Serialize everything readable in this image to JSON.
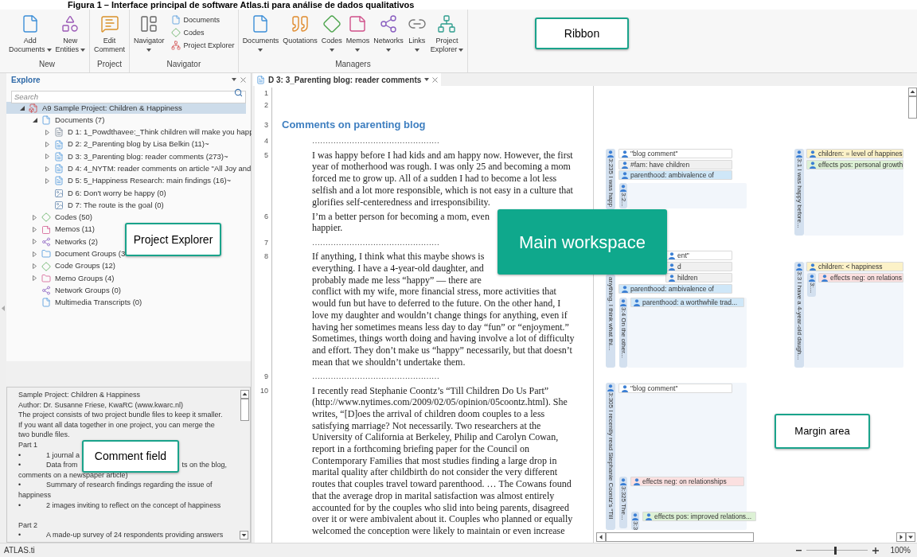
{
  "caption": "Figura 1 – Interface principal de software Atlas.ti para análise de dados qualitativos",
  "ribbon": {
    "groups": [
      {
        "label": "New",
        "buttons": [
          {
            "lines": [
              "Add",
              "Documents"
            ],
            "dropdown": true
          },
          {
            "lines": [
              "New",
              "Entities"
            ],
            "dropdown": true
          }
        ]
      },
      {
        "label": "Project",
        "buttons": [
          {
            "lines": [
              "Edit",
              "Comment"
            ],
            "dropdown": false
          }
        ]
      },
      {
        "label": "Navigator",
        "buttons": [
          {
            "lines": [
              "Navigator"
            ],
            "dropdown": true
          }
        ],
        "small_buttons": [
          "Documents",
          "Codes",
          "Project Explorer"
        ]
      },
      {
        "label": "Managers",
        "buttons": [
          {
            "lines": [
              "Documents"
            ],
            "dropdown": true
          },
          {
            "lines": [
              "Quotations"
            ],
            "dropdown": false
          },
          {
            "lines": [
              "Codes"
            ],
            "dropdown": true
          },
          {
            "lines": [
              "Memos"
            ],
            "dropdown": true
          },
          {
            "lines": [
              "Networks"
            ],
            "dropdown": true
          },
          {
            "lines": [
              "Links"
            ],
            "dropdown": true
          },
          {
            "lines": [
              "Project",
              "Explorer"
            ],
            "dropdown": true
          }
        ]
      }
    ]
  },
  "explorer": {
    "title": "Explore",
    "search": {
      "placeholder": "Search"
    },
    "tree": [
      {
        "label": "A9 Sample Project: Children & Happiness",
        "kind": "project",
        "expanded": true,
        "selected": true,
        "children": [
          {
            "label": "Documents (7)",
            "kind": "documents",
            "expanded": true,
            "selected": false,
            "children": [
              {
                "label": "D 1: 1_Powdthavee:_Think children will make you happ",
                "kind": "pdf",
                "expanded": false,
                "selected": false
              },
              {
                "label": "D 2: 2_Parenting blog by Lisa Belkin (11)~",
                "kind": "text",
                "expanded": false,
                "selected": false
              },
              {
                "label": "D 3: 3_Parenting blog: reader comments (273)~",
                "kind": "text",
                "expanded": false,
                "selected": false
              },
              {
                "label": "D 4: 4_NYTM: reader comments on article \"All Joy and",
                "kind": "text",
                "expanded": false,
                "selected": false
              },
              {
                "label": "D 5: 5_Happiness Research: main findings (16)~",
                "kind": "text",
                "expanded": false,
                "selected": false
              },
              {
                "label": "D 6: Don't worry be happy (0)",
                "kind": "image",
                "selected": false
              },
              {
                "label": "D 7: The route is the goal (0)",
                "kind": "image",
                "selected": false
              }
            ]
          },
          {
            "label": "Codes (50)",
            "kind": "codes",
            "expanded": false,
            "selected": false
          },
          {
            "label": "Memos (11)",
            "kind": "memos",
            "expanded": false,
            "selected": false
          },
          {
            "label": "Networks (2)",
            "kind": "networks",
            "expanded": false,
            "selected": false
          },
          {
            "label": "Document Groups (3",
            "kind": "docgroups",
            "expanded": false,
            "selected": false
          },
          {
            "label": "Code Groups (12)",
            "kind": "codegroups",
            "expanded": false,
            "selected": false
          },
          {
            "label": "Memo Groups (4)",
            "kind": "memogroups",
            "expanded": false,
            "selected": false
          },
          {
            "label": "Network Groups (0)",
            "kind": "netgroups",
            "selected": false
          },
          {
            "label": "Multimedia Transcripts (0)",
            "kind": "transcripts",
            "selected": false
          }
        ]
      }
    ]
  },
  "comment": {
    "lines": [
      {
        "kind": "text",
        "text": "Sample Project: Children & Happiness"
      },
      {
        "kind": "text",
        "text": "Author: Dr. Susanne Friese, KwaRC (www.kwarc.nl)"
      },
      {
        "kind": "text",
        "text": "The project consists of two project bundle files to keep it smaller."
      },
      {
        "kind": "text",
        "text": "If you want all data together in one project, you can merge the"
      },
      {
        "kind": "text",
        "text": "two bundle files."
      },
      {
        "kind": "text",
        "text": "Part 1"
      },
      {
        "kind": "bullet",
        "marker": "•",
        "text": "1 journal a"
      },
      {
        "kind": "bullet",
        "marker": "•",
        "text": "Data from",
        "tail": "ts on the blog,"
      },
      {
        "kind": "text",
        "text": "comments on a newspaper article)"
      },
      {
        "kind": "bullet",
        "marker": "•",
        "text": "Summary of research findings regarding the issue of"
      },
      {
        "kind": "text",
        "text": "happiness"
      },
      {
        "kind": "bullet",
        "marker": "•",
        "text": "2 images inviting to reflect on the concept of happiness"
      },
      {
        "kind": "blank"
      },
      {
        "kind": "text",
        "text": "Part 2"
      },
      {
        "kind": "bullet",
        "marker": "•",
        "text": "A made-up survey of 24 respondents providing answers"
      }
    ]
  },
  "document": {
    "tab": {
      "label": "D 3: 3_Parenting blog: reader comments",
      "selected": true
    },
    "rows": [
      {
        "number": "1",
        "kind": "blank"
      },
      {
        "number": "2",
        "kind": "blank"
      },
      {
        "number": "3",
        "kind": "heading",
        "lines": [
          "Comments on parenting blog"
        ]
      },
      {
        "number": "4",
        "kind": "separator",
        "lines": [
          "…………………………………………"
        ]
      },
      {
        "number": "5",
        "kind": "paragraph",
        "lines": [
          "I was happy before I had kids and am happy now. However, the first",
          "year of motherhood was rough. I was only 25 and becoming a mom",
          "forced me to grow up. All of a sudden I had to become a lot less",
          "selfish and a lot more responsible, which is not easy in a culture that",
          "glorifies self-centeredness and irresponsibility."
        ]
      },
      {
        "number": "6",
        "kind": "paragraph",
        "lines": [
          "I’m a better person for becoming a mom, even",
          "happier."
        ]
      },
      {
        "number": "7",
        "kind": "separator",
        "lines": [
          "…………………………………………"
        ]
      },
      {
        "number": "8",
        "kind": "paragraph",
        "lines": [
          "If anything, I think what this maybe shows is",
          "everything. I have a 4-year-old daughter, and",
          "probably made me less “happy” — there are",
          "conflict with my wife, more financial stress, more activities that",
          "would fun but have to deferred to the future. On the other hand, I",
          "love my daughter and wouldn’t change things for anything, even if",
          "having her sometimes means less day to day “fun” or “enjoyment.”",
          "Sometimes, things worth doing and having involve a lot of difficulty",
          "and effort. They don’t make us “happy” necessarily, but that doesn’t",
          "mean that we shouldn’t undertake them."
        ]
      },
      {
        "number": "9",
        "kind": "separator",
        "lines": [
          "…………………………………………"
        ]
      },
      {
        "number": "10",
        "kind": "paragraph",
        "lines": [
          "I recently read Stephanie Coontz’s “Till Children Do Us Part”",
          "(http://www.nytimes.com/2009/02/05/opinion/05coontz.html). She",
          "writes, “[D]oes the arrival of children doom couples to a less",
          "satisfying marriage? Not necessarily. Two researchers at the",
          "University of California at Berkeley, Philip and Carolyn Cowan,",
          "report in a forthcoming briefing paper for the Council on",
          "Contemporary Families that most studies finding a large drop in",
          "marital quality after childbirth do not consider the very different",
          "routes that couples travel toward parenthood. … The Cowans found",
          "that the average drop in marital satisfaction was almost entirely",
          "accounted for by the couples who slid into being parents, disagreed",
          "over it or were ambivalent about it. Couples who planned or equally",
          "welcomed the conception were likely to maintain or even increase"
        ]
      }
    ]
  },
  "margin": {
    "items": [
      {
        "kind": "quotation",
        "label": "3:235 I was happ"
      },
      {
        "kind": "code",
        "label": "\"blog comment\"",
        "color": "#ffffff"
      },
      {
        "kind": "code",
        "label": "#fam: have children",
        "color": "#f0f0f0"
      },
      {
        "kind": "code",
        "label": "parenthood: ambivalence of",
        "color": "#cfe7f8"
      },
      {
        "kind": "quotation",
        "label": "3:2..."
      },
      {
        "kind": "quotation",
        "label": "3:1 I was happy before..."
      },
      {
        "kind": "code",
        "label": "children: = level of happines",
        "color": "#fcf2c8"
      },
      {
        "kind": "code",
        "label": "effects pos: personal growth",
        "color": "#ddf1d5"
      },
      {
        "kind": "code",
        "label": "ent\"",
        "color": "#ffffff"
      },
      {
        "kind": "code",
        "label": "d",
        "color": "#f0f0f0"
      },
      {
        "kind": "code",
        "label": "hildren",
        "color": "#f0f0f0"
      },
      {
        "kind": "code",
        "label": "parenthood: ambivalence of",
        "color": "#cfe7f8"
      },
      {
        "kind": "quotation",
        "label": "anything. I think what thi..."
      },
      {
        "kind": "quotation",
        "label": "3:4 On the other..."
      },
      {
        "kind": "code",
        "label": "parenthood: a worthwhile trad...",
        "color": "#cfe7f8"
      },
      {
        "kind": "quotation",
        "label": "3:3 I have a 4-year-old daugh..."
      },
      {
        "kind": "code",
        "label": "children: < happiness",
        "color": "#fcf2c8"
      },
      {
        "kind": "quotation",
        "label": "3:..."
      },
      {
        "kind": "code",
        "label": "effects neg: on relations",
        "color": "#fbe0e0"
      },
      {
        "kind": "quotation",
        "label": "3:305 I recently read Stephanie Coontz’s “Till"
      },
      {
        "kind": "code",
        "label": "\"blog comment\"",
        "color": "#ffffff"
      },
      {
        "kind": "quotation",
        "label": "3:325 The..."
      },
      {
        "kind": "code",
        "label": "effects neg: on relationships",
        "color": "#fbe0e0"
      },
      {
        "kind": "quotation",
        "label": "3:3"
      },
      {
        "kind": "code",
        "label": "effects pos: improved relations...",
        "color": "#ddf1d5"
      }
    ]
  },
  "status_bar": {
    "app_name": "ATLAS.ti",
    "zoom": {
      "level": 0.47,
      "reading": "100%"
    }
  },
  "callouts": [
    {
      "label": "Ribbon",
      "filled": false
    },
    {
      "label": "Project Explorer",
      "filled": false
    },
    {
      "label": "Main workspace",
      "filled": true
    },
    {
      "label": "Comment field",
      "filled": false
    },
    {
      "label": "Margin area",
      "filled": false
    }
  ]
}
